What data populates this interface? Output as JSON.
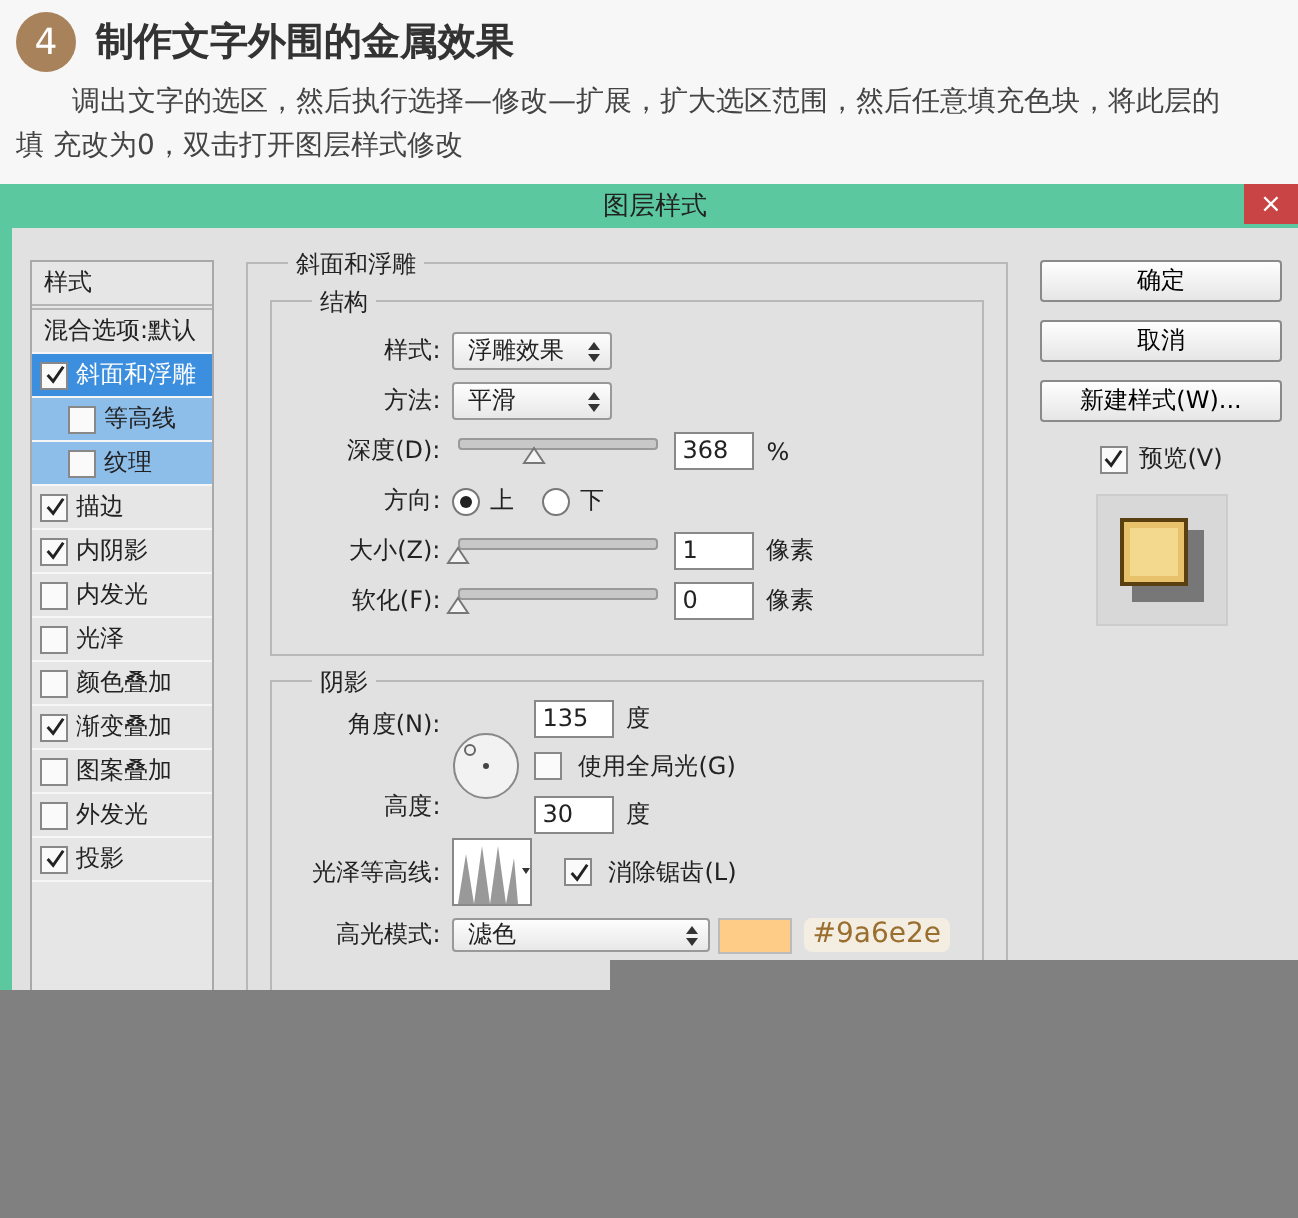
{
  "step": {
    "number": "4",
    "title": "制作文字外围的金属效果"
  },
  "intro": "调出文字的选区，然后执行选择—修改—扩展，扩大选区范围，然后任意填充色块，将此层的填 充改为0，双击打开图层样式修改",
  "dialog": {
    "title": "图层样式",
    "close": "×",
    "styles_header": "样式",
    "styles": [
      {
        "label": "混合选项:默认",
        "kind": "option",
        "selected": false
      },
      {
        "label": "斜面和浮雕",
        "kind": "check",
        "checked": true,
        "selected": true,
        "children": [
          {
            "label": "等高线",
            "checked": false,
            "selected": false
          },
          {
            "label": "纹理",
            "checked": false,
            "selected": false
          }
        ]
      },
      {
        "label": "描边",
        "kind": "check",
        "checked": true,
        "selected": false
      },
      {
        "label": "内阴影",
        "kind": "check",
        "checked": true,
        "selected": false
      },
      {
        "label": "内发光",
        "kind": "check",
        "checked": false,
        "selected": false
      },
      {
        "label": "光泽",
        "kind": "check",
        "checked": false,
        "selected": false
      },
      {
        "label": "颜色叠加",
        "kind": "check",
        "checked": false,
        "selected": false
      },
      {
        "label": "渐变叠加",
        "kind": "check",
        "checked": true,
        "selected": false
      },
      {
        "label": "图案叠加",
        "kind": "check",
        "checked": false,
        "selected": false
      },
      {
        "label": "外发光",
        "kind": "check",
        "checked": false,
        "selected": false
      },
      {
        "label": "投影",
        "kind": "check",
        "checked": true,
        "selected": false
      }
    ],
    "bevel": {
      "title": "斜面和浮雕",
      "structure": {
        "title": "结构",
        "style": {
          "label": "样式:",
          "value": "浮雕效果"
        },
        "technique": {
          "label": "方法:",
          "value": "平滑"
        },
        "depth": {
          "label": "深度(D):",
          "level": 0.36,
          "value": "368",
          "unit": "%"
        },
        "direction": {
          "label": "方向:",
          "options": [
            {
              "label": "上",
              "selected": true
            },
            {
              "label": "下",
              "selected": false
            }
          ]
        },
        "size": {
          "label": "大小(Z):",
          "level": 0,
          "value": "1",
          "unit": "像素"
        },
        "soften": {
          "label": "软化(F):",
          "level": 0,
          "value": "0",
          "unit": "像素"
        }
      },
      "shading": {
        "title": "阴影",
        "angle": {
          "label": "角度(N):",
          "value": "135",
          "unit": "度"
        },
        "global_light": {
          "label": "使用全局光(G)",
          "checked": false
        },
        "altitude": {
          "label": "高度:",
          "value": "30",
          "unit": "度"
        },
        "gloss_contour": {
          "label": "光泽等高线:"
        },
        "anti_alias": {
          "label": "消除锯齿(L)",
          "checked": true
        },
        "highlight_mode": {
          "label": "高光模式:",
          "value": "滤色"
        },
        "color_note": "#9a6e2e"
      }
    },
    "buttons": [
      "确定",
      "取消",
      "新建样式(W)..."
    ],
    "preview": {
      "label": "预览(V)",
      "checked": true
    }
  }
}
